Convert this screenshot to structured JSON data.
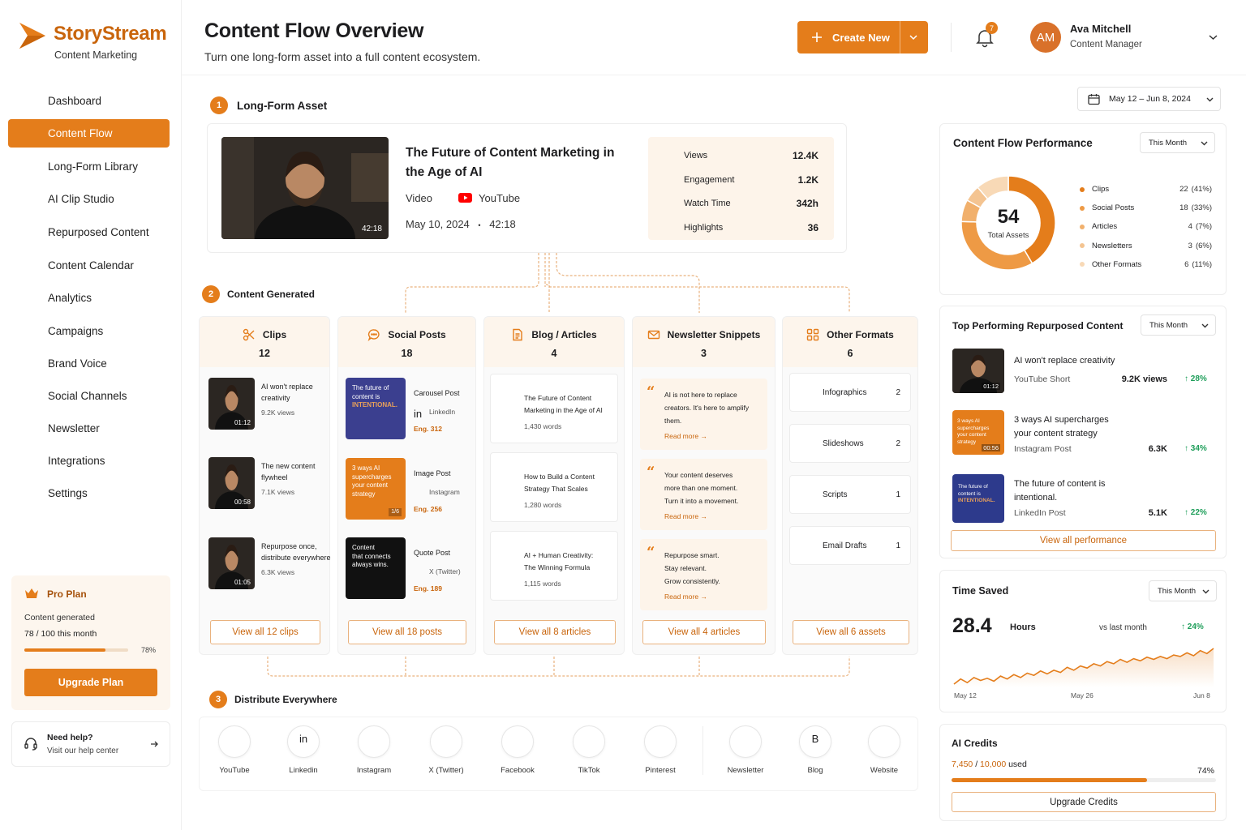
{
  "brand": {
    "name": "StoryStream",
    "subtitle": "Content Marketing"
  },
  "nav": [
    {
      "label": "Dashboard",
      "icon": "home-icon"
    },
    {
      "label": "Content Flow",
      "icon": "layout-icon",
      "active": true
    },
    {
      "label": "Long-Form Library",
      "icon": "document-icon"
    },
    {
      "label": "AI Clip Studio",
      "icon": "pen-icon"
    },
    {
      "label": "Repurposed Content",
      "icon": "image-icon"
    },
    {
      "label": "Content Calendar",
      "icon": "calendar-icon"
    },
    {
      "label": "Analytics",
      "icon": "bar-chart-icon"
    },
    {
      "label": "Campaigns",
      "icon": "send-icon"
    },
    {
      "label": "Brand Voice",
      "icon": "brand-icon"
    },
    {
      "label": "Social Channels",
      "icon": "check-circle-icon"
    },
    {
      "label": "Newsletter",
      "icon": "mail-icon"
    },
    {
      "label": "Integrations",
      "icon": "plug-icon"
    },
    {
      "label": "Settings",
      "icon": "gear-icon"
    }
  ],
  "plan": {
    "title": "Pro Plan",
    "label": "Content generated",
    "used": "78",
    "total": "100",
    "suffix": "this month",
    "percent_text": "78%",
    "percent": 78,
    "upgrade": "Upgrade Plan"
  },
  "help": {
    "title": "Need help?",
    "subtitle": "Visit our help center"
  },
  "header": {
    "title": "Content Flow Overview",
    "subtitle": "Turn one long-form asset into a full content ecosystem.",
    "create": "Create New",
    "notifications": "7"
  },
  "user": {
    "initials": "AM",
    "name": "Ava Mitchell",
    "role": "Content Manager"
  },
  "date_range": "May 12 – Jun 8, 2024",
  "step1": {
    "num": "1",
    "title": "Long-Form Asset"
  },
  "asset": {
    "title_line1": "The Future of Content Marketing in",
    "title_line2": "the Age of AI",
    "type": "Video",
    "platform": "YouTube",
    "date": "May 10, 2024",
    "dot": "•",
    "duration": "42:18",
    "stats": [
      {
        "label": "Views",
        "value": "12.4K",
        "icon": "eye-icon"
      },
      {
        "label": "Engagement",
        "value": "1.2K",
        "icon": "heart-icon"
      },
      {
        "label": "Watch Time",
        "value": "342h",
        "icon": "clock-icon"
      },
      {
        "label": "Highlights",
        "value": "36",
        "icon": "star-icon"
      }
    ]
  },
  "step2": {
    "num": "2",
    "title": "Content Generated"
  },
  "columns": {
    "clips": {
      "title": "Clips",
      "count": "12",
      "button": "View all 12 clips",
      "items": [
        {
          "title_l1": "AI won't replace",
          "title_l2": "creativity",
          "views": "9.2K views",
          "time": "01:12"
        },
        {
          "title_l1": "The new content",
          "title_l2": "flywheel",
          "views": "7.1K views",
          "time": "00:58"
        },
        {
          "title_l1": "Repurpose once,",
          "title_l2": "distribute everywhere",
          "views": "6.3K views",
          "time": "01:05"
        }
      ]
    },
    "social": {
      "title": "Social Posts",
      "count": "18",
      "button": "View all 18 posts",
      "items": [
        {
          "type": "Carousel Post",
          "network": "LinkedIn",
          "eng": "Eng. 312",
          "thumb_l1": "The future of",
          "thumb_l2": "content is",
          "thumb_l3": "INTENTIONAL."
        },
        {
          "type": "Image Post",
          "network": "Instagram",
          "eng": "Eng. 256",
          "thumb_l1": "3 ways AI",
          "thumb_l2": "supercharges",
          "thumb_l3": "your content",
          "thumb_l4": "strategy",
          "thumb_tag": "1/6"
        },
        {
          "type": "Quote Post",
          "network": "X (Twitter)",
          "eng": "Eng. 189",
          "thumb_l1": "Content",
          "thumb_l2": "that connects",
          "thumb_l3": "always wins."
        }
      ]
    },
    "blog": {
      "title": "Blog / Articles",
      "count": "4",
      "button": "View all 8 articles",
      "items": [
        {
          "l1": "The Future of Content",
          "l2": "Marketing in the Age of AI",
          "words": "1,430 words"
        },
        {
          "l1": "How to Build a Content",
          "l2": "Strategy That Scales",
          "words": "1,280 words"
        },
        {
          "l1": "AI + Human Creativity:",
          "l2": "The Winning Formula",
          "words": "1,115 words"
        }
      ]
    },
    "newsletter": {
      "title": "Newsletter Snippets",
      "count": "3",
      "button": "View all 4 articles",
      "read_more": "Read more",
      "items": [
        {
          "l1": "AI is not here to replace",
          "l2": "creators. It's here to amplify",
          "l3": "them."
        },
        {
          "l1": "Your content deserves",
          "l2": "more than one moment.",
          "l3": "Turn it into a movement."
        },
        {
          "l1": "Repurpose smart.",
          "l2": "Stay relevant.",
          "l3": "Grow consistently."
        }
      ]
    },
    "other": {
      "title": "Other Formats",
      "count": "6",
      "button": "View all 6 assets",
      "items": [
        {
          "label": "Infographics",
          "count": "2"
        },
        {
          "label": "Slideshows",
          "count": "2"
        },
        {
          "label": "Scripts",
          "count": "1"
        },
        {
          "label": "Email Drafts",
          "count": "1"
        }
      ]
    }
  },
  "step3": {
    "num": "3",
    "title": "Distribute Everywhere"
  },
  "channels": [
    {
      "label": "YouTube",
      "icon": "youtube-icon",
      "color": "#ff0000"
    },
    {
      "label": "Linkedin",
      "icon": "linkedin-icon",
      "color": "#0a66c2"
    },
    {
      "label": "Instagram",
      "icon": "instagram-icon",
      "color": "#d62976"
    },
    {
      "label": "X (Twitter)",
      "icon": "x-icon",
      "color": "#000000"
    },
    {
      "label": "Facebook",
      "icon": "facebook-icon",
      "color": "#1877f2"
    },
    {
      "label": "TikTok",
      "icon": "tiktok-icon",
      "color": "#000000"
    },
    {
      "label": "Pinterest",
      "icon": "pinterest-icon",
      "color": "#e60023"
    },
    {
      "label": "Newsletter",
      "icon": "mail-icon",
      "color": "#e47d1b"
    },
    {
      "label": "Blog",
      "icon": "blogger-icon",
      "color": "#e47d1b"
    },
    {
      "label": "Website",
      "icon": "globe-icon",
      "color": "#222222"
    }
  ],
  "performance": {
    "title": "Content Flow Performance",
    "period": "This Month",
    "total": "54",
    "total_label": "Total Assets",
    "legend": [
      {
        "label": "Clips",
        "value": "22",
        "pct": "(41%)",
        "color": "#e47d1b",
        "n": 22
      },
      {
        "label": "Social Posts",
        "value": "18",
        "pct": "(33%)",
        "color": "#ee9a45",
        "n": 18
      },
      {
        "label": "Articles",
        "value": "4",
        "pct": "(7%)",
        "color": "#f1b06c",
        "n": 4
      },
      {
        "label": "Newsletters",
        "value": "3",
        "pct": "(6%)",
        "color": "#f4c491",
        "n": 3
      },
      {
        "label": "Other Formats",
        "value": "6",
        "pct": "(11%)",
        "color": "#f8d9b6",
        "n": 6
      }
    ]
  },
  "top": {
    "title": "Top Performing Repurposed Content",
    "period": "This Month",
    "button": "View all performance",
    "items": [
      {
        "l1": "AI won't replace creativity",
        "l2": "",
        "type": "YouTube Short",
        "views": "9.2K views",
        "growth": "28%",
        "time": "01:12"
      },
      {
        "l1": "3 ways AI supercharges",
        "l2": "your content strategy",
        "type": "Instagram Post",
        "views": "6.3K",
        "growth": "34%",
        "time": "00:56"
      },
      {
        "l1": "The future of content is",
        "l2": "intentional.",
        "type": "LinkedIn Post",
        "views": "5.1K",
        "growth": "22%"
      }
    ]
  },
  "time_saved": {
    "title": "Time Saved",
    "period": "This Month",
    "value": "28.4",
    "unit": "Hours",
    "vs": "vs last month",
    "growth": "24%",
    "x_labels": [
      "May 12",
      "May 26",
      "Jun 8"
    ],
    "series": [
      2.1,
      2.8,
      2.3,
      3.0,
      2.6,
      2.9,
      2.5,
      3.2,
      2.8,
      3.4,
      3.0,
      3.6,
      3.3,
      3.9,
      3.5,
      4.0,
      3.7,
      4.4,
      4.0,
      4.6,
      4.3,
      4.9,
      4.6,
      5.2,
      4.9,
      5.5,
      5.1,
      5.6,
      5.3,
      5.8,
      5.5,
      5.9,
      5.6,
      6.1,
      5.9,
      6.4,
      6.0,
      6.7,
      6.3,
      7.0
    ]
  },
  "credits": {
    "title": "AI Credits",
    "used": "7,450",
    "total": "10,000",
    "suffix": "used",
    "percent_text": "74%",
    "percent": 74,
    "button": "Upgrade Credits"
  }
}
